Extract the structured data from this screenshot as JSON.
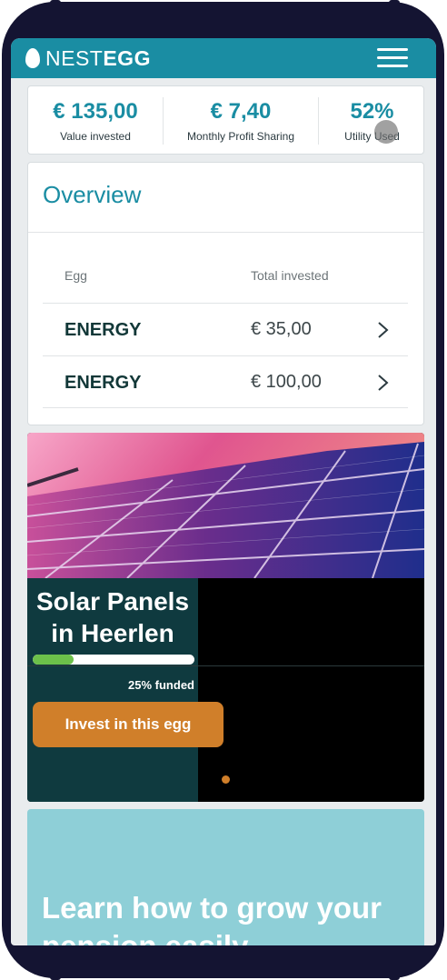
{
  "app": {
    "logo_light": "NEST",
    "logo_bold": "EGG"
  },
  "stats": [
    {
      "value": "€ 135,00",
      "label": "Value invested"
    },
    {
      "value": "€ 7,40",
      "label": "Monthly Profit Sharing"
    },
    {
      "value": "52%",
      "label": "Utility Used"
    }
  ],
  "overview": {
    "title": "Overview",
    "col_egg": "Egg",
    "col_total": "Total invested",
    "rows": [
      {
        "egg": "ENERGY",
        "amount": "€ 35,00"
      },
      {
        "egg": "ENERGY",
        "amount": "€ 100,00"
      }
    ]
  },
  "project": {
    "title_line1": "Solar Panels",
    "title_line2": "in Heerlen",
    "funded_fraction": 0.25,
    "funded_label": "25% funded",
    "invest_label": "Invest in this egg"
  },
  "learn": {
    "text": "Learn how to grow your pension easily"
  },
  "colors": {
    "brand": "#1a8da3",
    "accent": "#d07f2a",
    "progress": "#6cc04a",
    "panel": "#0f3a3f",
    "learn_bg": "#8ecfd7"
  }
}
